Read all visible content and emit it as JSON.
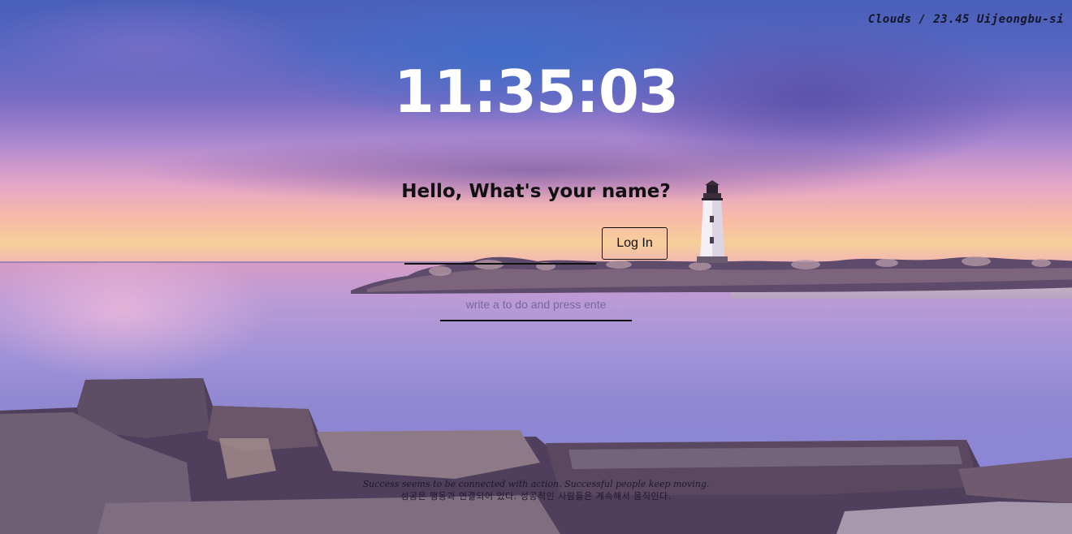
{
  "weather": {
    "text": "Clouds / 23.45 Uijeongbu-si"
  },
  "clock": {
    "time": "11:35:03"
  },
  "login": {
    "greeting": "Hello, What's your name?",
    "name_value": "",
    "button_label": "Log In"
  },
  "todo": {
    "placeholder": "write a to do and press ente",
    "value": ""
  },
  "quote": {
    "english": "Success seems to be connected with action. Successful people keep moving.",
    "korean": "성공은 행동과 연결되어 있다. 성공적인 사람들은 계속해서 움직인다."
  },
  "colors": {
    "clock_text": "#ffffff",
    "ui_text": "#111111",
    "underline": "#111111"
  },
  "background": {
    "scene": "sunset-sea-lighthouse"
  }
}
